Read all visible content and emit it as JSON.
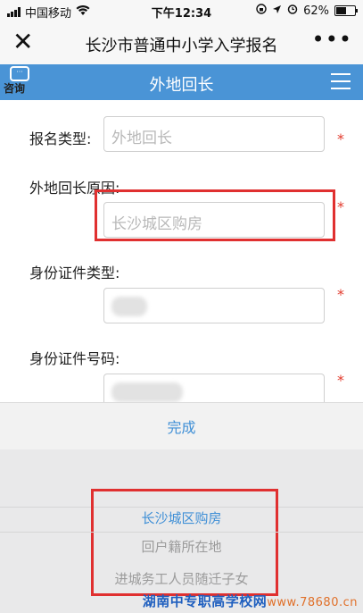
{
  "status_bar": {
    "carrier": "中国移动",
    "time": "下午12:34",
    "battery": "62%",
    "battery_level": 0.62,
    "icons": [
      "signal-icon",
      "wifi-icon",
      "lock-rotation-icon",
      "location-icon",
      "alarm-icon",
      "battery-icon"
    ]
  },
  "title_bar": {
    "close_icon": "close-icon",
    "title": "长沙市普通中小学入学报名",
    "more_icon": "more-icon"
  },
  "header": {
    "consult_label": "咨询",
    "title": "外地回长",
    "menu_icon": "hamburger-menu-icon",
    "color": "#4a94d6"
  },
  "form": {
    "fields": [
      {
        "label": "报名类型:",
        "value": "外地回长",
        "required": "*"
      },
      {
        "label": "外地回长原因:",
        "value": "长沙城区购房",
        "required": "*"
      },
      {
        "label": "身份证件类型:",
        "value": "",
        "required": "*"
      },
      {
        "label": "身份证件号码:",
        "value": "",
        "required": "*"
      }
    ],
    "required_color": "#e23a2c",
    "highlight_color": "#e03030"
  },
  "picker": {
    "done_label": "完成",
    "options": [
      "长沙城区购房",
      "回户籍所在地",
      "进城务工人员随迁子女"
    ],
    "selected": "长沙城区购房",
    "accent_color": "#3f8fd6"
  },
  "watermark": {
    "text": "湖南中专职高学校网",
    "url": "www.78680.cn"
  }
}
